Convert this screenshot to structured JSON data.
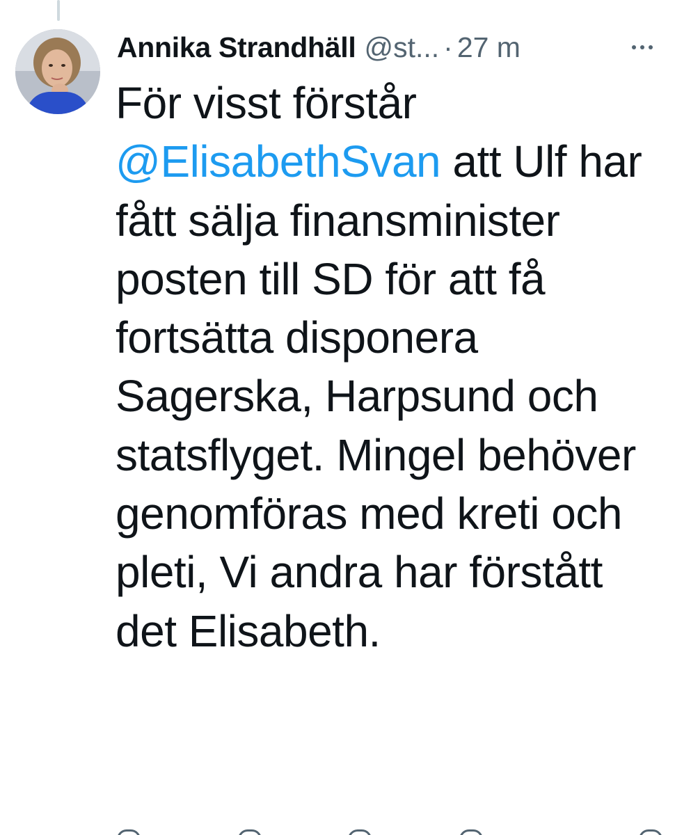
{
  "tweet": {
    "author": {
      "display_name": "Annika Strandhäll",
      "handle": "@st...",
      "separator": "·",
      "time": "27 m"
    },
    "menu_icon": "more-horizontal-icon",
    "text_segments": [
      {
        "type": "text",
        "value": "För visst förstår "
      },
      {
        "type": "mention",
        "value": "@ElisabethSvan"
      },
      {
        "type": "text",
        "value": " att Ulf har fått sälja finansminister posten till SD för att få fortsätta disponera Sagerska, Harpsund och statsflyget. Mingel behöver genomföras med kreti och pleti, Vi andra har förstått det Elisabeth."
      }
    ],
    "action_icons": [
      "reply-icon",
      "retweet-icon",
      "like-icon",
      "views-icon",
      "share-icon"
    ],
    "colors": {
      "text": "#0f1419",
      "secondary": "#536471",
      "link": "#1d9bf0"
    }
  }
}
